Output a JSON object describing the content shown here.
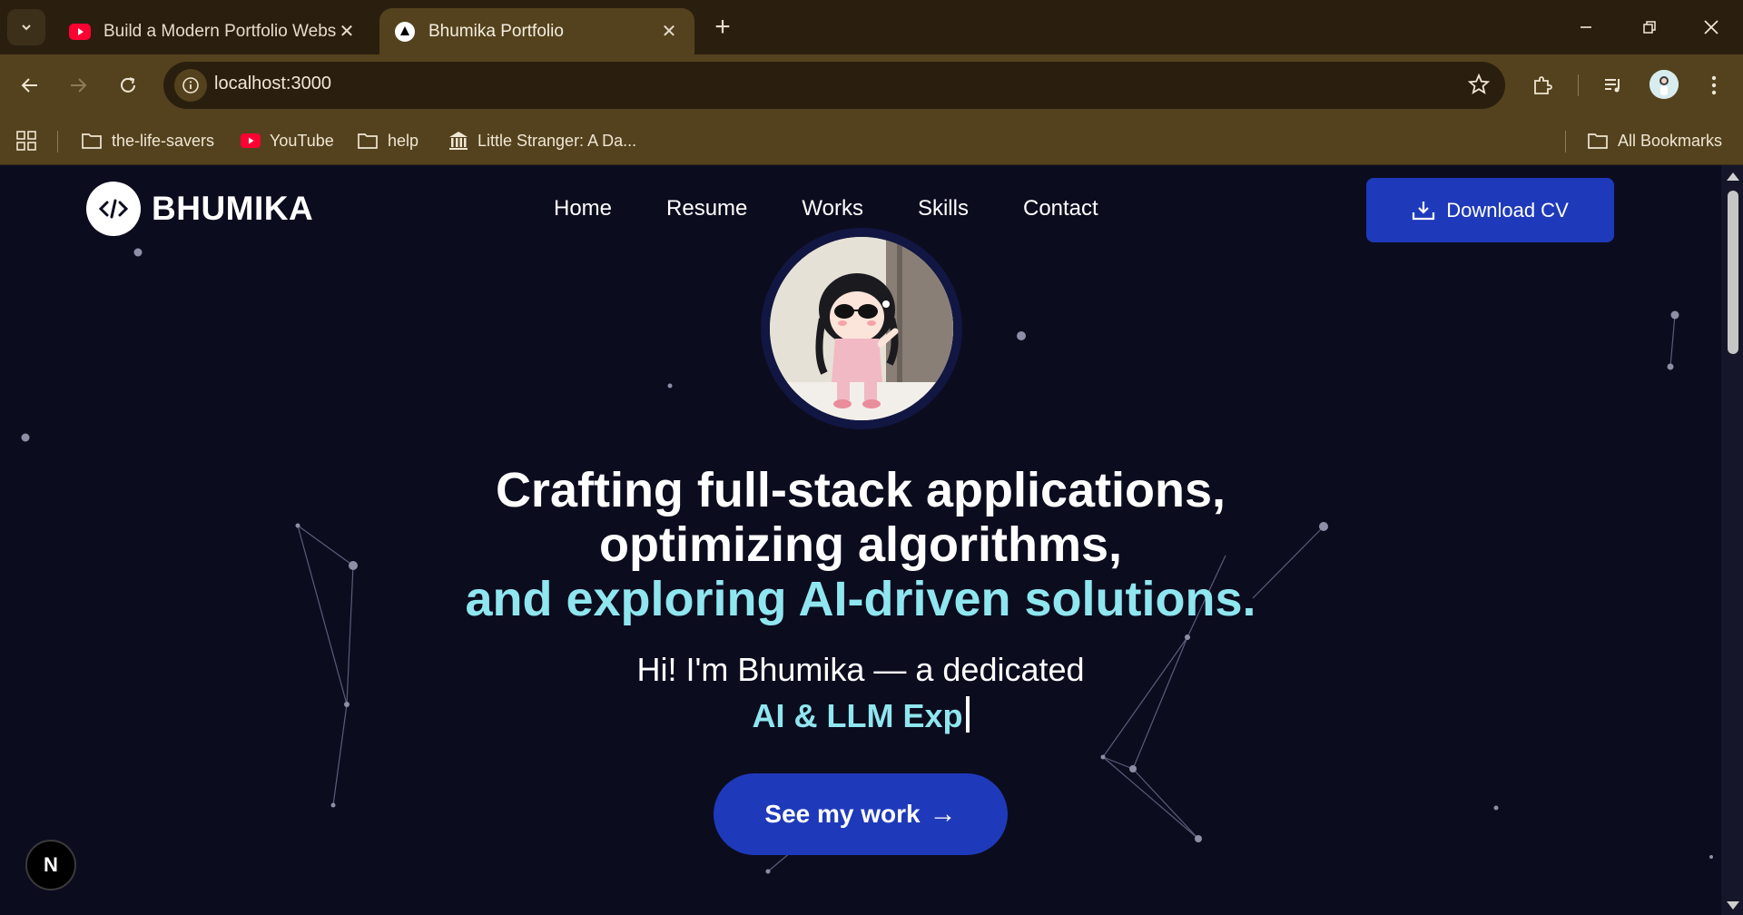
{
  "browser": {
    "tabs": [
      {
        "title": "Build a Modern Portfolio Website",
        "favicon": "youtube-icon",
        "active": false
      },
      {
        "title": "Bhumika Portfolio",
        "favicon": "nextjs-icon",
        "active": true
      }
    ],
    "address": "localhost:3000",
    "bookmarks": [
      {
        "label": "the-life-savers",
        "icon": "folder-icon"
      },
      {
        "label": "YouTube",
        "icon": "youtube-icon"
      },
      {
        "label": "help",
        "icon": "folder-icon"
      },
      {
        "label": "Little Stranger: A Da...",
        "icon": "museum-icon"
      }
    ],
    "all_bookmarks": "All Bookmarks"
  },
  "site": {
    "logo_text": "BHUMIKA",
    "nav": [
      "Home",
      "Resume",
      "Works",
      "Skills",
      "Contact"
    ],
    "cv_button": "Download CV",
    "headline_line1": "Crafting full-stack applications,",
    "headline_line2": "optimizing algorithms,",
    "headline_line3": "and exploring AI-driven solutions.",
    "intro": "Hi! I'm Bhumika — a dedicated",
    "typed_text": "AI & LLM Exp",
    "cta_button": "See my work",
    "cta_arrow": "→",
    "dev_badge": "N"
  },
  "colors": {
    "accent": "#8fe6ef",
    "button": "#1e3aba",
    "page_bg": "#0c0c1f",
    "chrome": "#54421e"
  }
}
